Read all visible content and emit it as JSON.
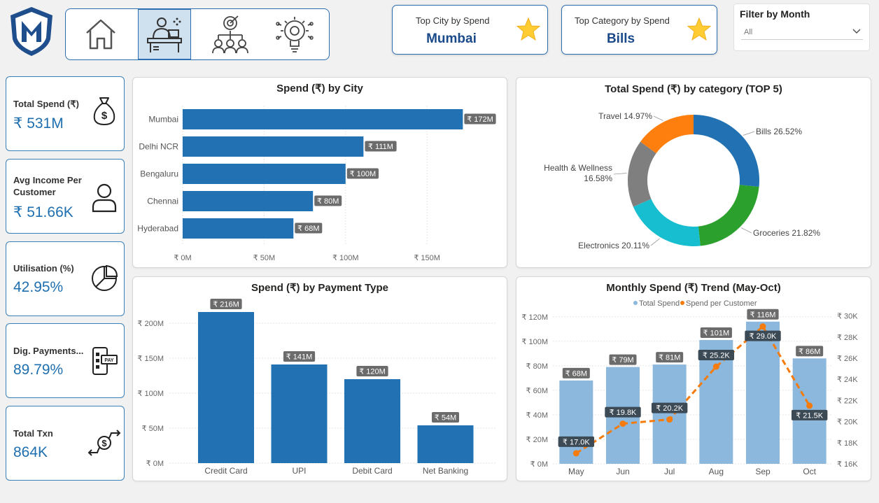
{
  "nav": {
    "items": [
      {
        "name": "home",
        "icon": "home-icon"
      },
      {
        "name": "desk",
        "icon": "person-at-desk-icon"
      },
      {
        "name": "target-team",
        "icon": "target-team-icon"
      },
      {
        "name": "idea",
        "icon": "lightbulb-gear-icon"
      }
    ],
    "active_index": 1,
    "logo_icon": "m-shield-logo-icon"
  },
  "top_city": {
    "label": "Top City by Spend",
    "value": "Mumbai",
    "icon": "star-icon"
  },
  "top_category": {
    "label": "Top Category by Spend",
    "value": "Bills",
    "icon": "star-icon"
  },
  "filter": {
    "label": "Filter by Month",
    "value": "All"
  },
  "kpis": [
    {
      "label": "Total Spend (₹)",
      "value": "₹ 531M",
      "icon": "money-bag-icon"
    },
    {
      "label": "Avg Income Per Customer",
      "value": "₹ 51.66K",
      "icon": "user-icon"
    },
    {
      "label": "Utilisation (%)",
      "value": "42.95%",
      "icon": "pie-chart-icon"
    },
    {
      "label": "Dig. Payments...",
      "value": "89.79%",
      "icon": "mobile-pay-icon"
    },
    {
      "label": "Total Txn",
      "value": "864K",
      "icon": "money-exchange-icon"
    }
  ],
  "colors": {
    "accent": "#2271b3",
    "orange": "#f47b0c",
    "light_blue": "#8bb8dc",
    "kpi_value": "#1f6faf"
  },
  "chart_data": [
    {
      "id": "city",
      "type": "bar",
      "orientation": "horizontal",
      "title": "Spend (₹) by City",
      "categories": [
        "Mumbai",
        "Delhi NCR",
        "Bengaluru",
        "Chennai",
        "Hyderabad"
      ],
      "values": [
        172,
        111,
        100,
        80,
        68
      ],
      "data_labels": [
        "₹ 172M",
        "₹ 111M",
        "₹ 100M",
        "₹ 80M",
        "₹ 68M"
      ],
      "xlim": [
        0,
        180
      ],
      "xticks": [
        0,
        50,
        100,
        150
      ],
      "xtick_labels": [
        "₹ 0M",
        "₹ 50M",
        "₹ 100M",
        "₹ 150M"
      ],
      "color": "#2271b3",
      "grid": true
    },
    {
      "id": "category",
      "type": "pie",
      "donut": true,
      "title": "Total Spend (₹) by category (TOP 5)",
      "categories": [
        "Bills",
        "Groceries",
        "Electronics",
        "Health & Wellness",
        "Travel"
      ],
      "values": [
        26.52,
        21.82,
        20.11,
        16.58,
        14.97
      ],
      "labels": [
        "Bills 26.52%",
        "Groceries 21.82%",
        "Electronics 20.11%",
        "Health & Wellness 16.58%",
        "Travel 14.97%"
      ],
      "colors": [
        "#2271b3",
        "#2ca02c",
        "#17becf",
        "#7f7f7f",
        "#ff7f0e"
      ]
    },
    {
      "id": "payment",
      "type": "bar",
      "title": "Spend (₹) by Payment Type",
      "categories": [
        "Credit Card",
        "UPI",
        "Debit Card",
        "Net Banking"
      ],
      "values": [
        216,
        141,
        120,
        54
      ],
      "data_labels": [
        "₹ 216M",
        "₹ 141M",
        "₹ 120M",
        "₹ 54M"
      ],
      "ylim": [
        0,
        230
      ],
      "yticks": [
        0,
        50,
        100,
        150,
        200
      ],
      "ytick_labels": [
        "₹ 0M",
        "₹ 50M",
        "₹ 100M",
        "₹ 150M",
        "₹ 200M"
      ],
      "color": "#2271b3",
      "grid": true
    },
    {
      "id": "trend",
      "type": "bar",
      "combo": "bar-line",
      "title": "Monthly Spend (₹) Trend (May-Oct)",
      "categories": [
        "May",
        "Jun",
        "Jul",
        "Aug",
        "Sep",
        "Oct"
      ],
      "legend_position": "top-center",
      "series": [
        {
          "name": "Total Spend",
          "type": "bar",
          "axis": "left",
          "values": [
            68,
            79,
            81,
            101,
            116,
            86
          ],
          "data_labels": [
            "₹ 68M",
            "₹ 79M",
            "₹ 81M",
            "₹ 101M",
            "₹ 116M",
            "₹ 86M"
          ],
          "color": "#8bb8dc"
        },
        {
          "name": "Spend per Customer",
          "type": "line",
          "axis": "right",
          "style": "dashed",
          "values": [
            17.0,
            19.8,
            20.2,
            25.2,
            29.0,
            21.5
          ],
          "data_labels": [
            "₹ 17.0K",
            "₹ 19.8K",
            "₹ 20.2K",
            "₹ 25.2K",
            "₹ 29.0K",
            "₹ 21.5K"
          ],
          "color": "#f47b0c"
        }
      ],
      "ylim_left": [
        0,
        125
      ],
      "yticks_left": [
        0,
        20,
        40,
        60,
        80,
        100,
        120
      ],
      "ytick_labels_left": [
        "₹ 0M",
        "₹ 20M",
        "₹ 40M",
        "₹ 60M",
        "₹ 80M",
        "₹ 100M",
        "₹ 120M"
      ],
      "ylim_right": [
        16,
        30.5
      ],
      "yticks_right": [
        16,
        18,
        20,
        22,
        24,
        26,
        28,
        30
      ],
      "ytick_labels_right": [
        "₹ 16K",
        "₹ 18K",
        "₹ 20K",
        "₹ 22K",
        "₹ 24K",
        "₹ 26K",
        "₹ 28K",
        "₹ 30K"
      ],
      "grid": true
    }
  ]
}
